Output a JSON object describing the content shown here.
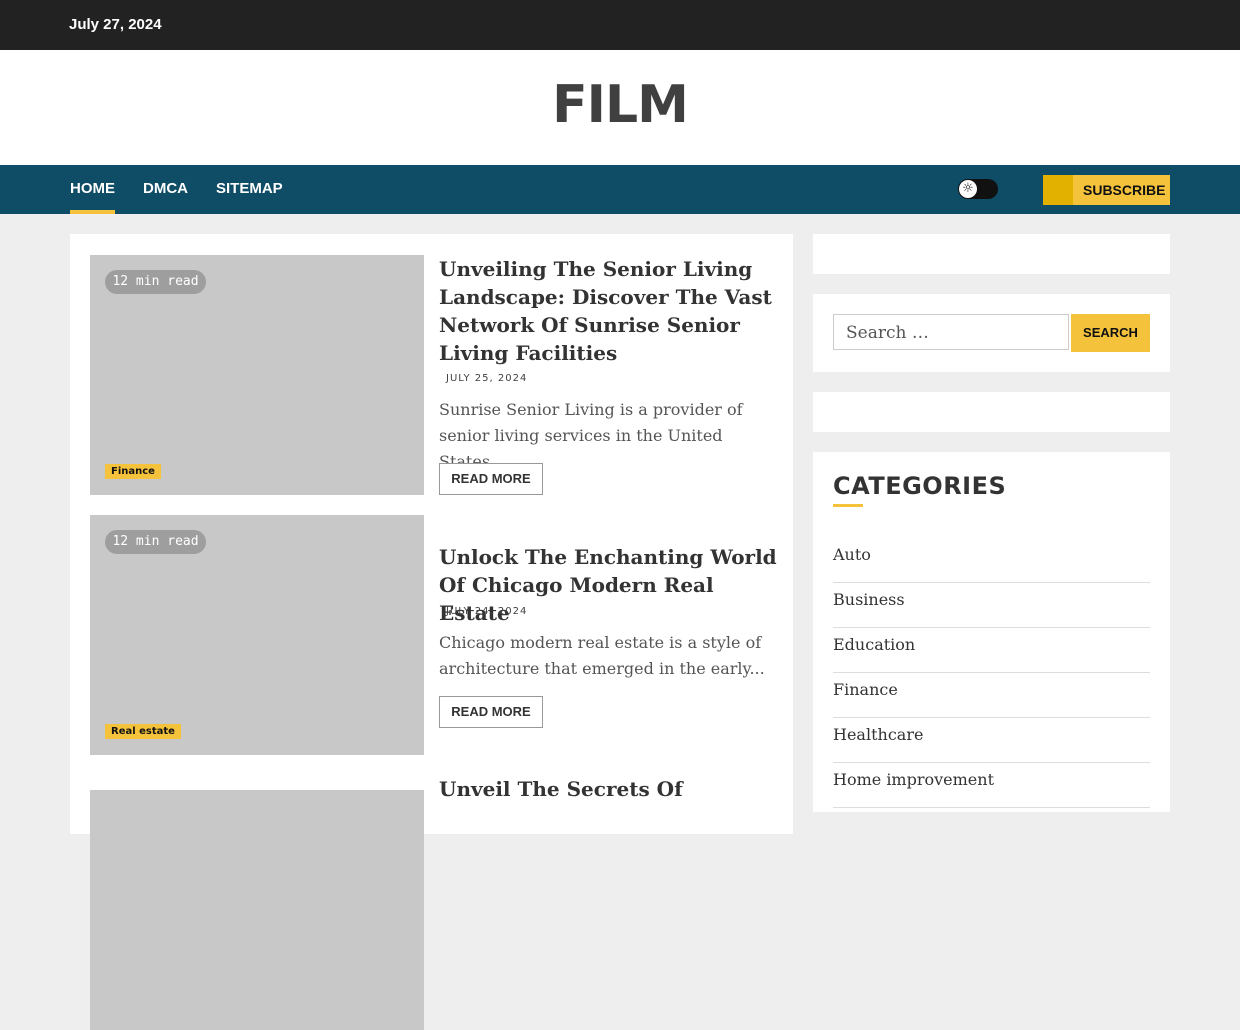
{
  "topbar": {
    "date": "July 27, 2024"
  },
  "header": {
    "site_title": "FILM"
  },
  "nav": {
    "items": [
      {
        "label": "HOME"
      },
      {
        "label": "DMCA"
      },
      {
        "label": "SITEMAP"
      }
    ],
    "subscribe_label": "SUBSCRIBE",
    "theme_toggle_icon": "sun-icon"
  },
  "posts": [
    {
      "read_time": "12 min read",
      "category": "Finance",
      "title": "Unveiling The Senior Living Landscape: Discover The Vast Network Of Sunrise Senior Living Facilities",
      "date": "JULY 25, 2024",
      "excerpt": "Sunrise Senior Living is a provider of senior living services in the United States,...",
      "read_more": "READ MORE"
    },
    {
      "read_time": "12 min read",
      "category": "Real estate",
      "title": "Unlock The Enchanting World Of Chicago Modern Real Estate",
      "date": "JULY 24, 2024",
      "excerpt": "Chicago modern real estate is a style of architecture that emerged in the early...",
      "read_more": "READ MORE"
    },
    {
      "title": "Unveil The Secrets Of"
    }
  ],
  "sidebar": {
    "search": {
      "placeholder": "Search …",
      "button": "SEARCH"
    },
    "categories": {
      "heading": "CATEGORIES",
      "items": [
        "Auto",
        "Business",
        "Education",
        "Finance",
        "Healthcare",
        "Home improvement"
      ]
    }
  },
  "colors": {
    "accent": "#f5c33b",
    "nav_bg": "#0f4c66",
    "topbar_bg": "#222222"
  }
}
